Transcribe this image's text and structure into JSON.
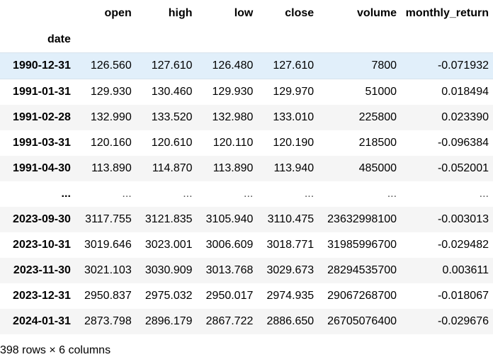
{
  "columns": [
    "open",
    "high",
    "low",
    "close",
    "volume",
    "monthly_return"
  ],
  "index_name": "date",
  "rows": [
    {
      "index": "1990-12-31",
      "open": "126.560",
      "high": "127.610",
      "low": "126.480",
      "close": "127.610",
      "volume": "7800",
      "monthly_return": "-0.071932"
    },
    {
      "index": "1991-01-31",
      "open": "129.930",
      "high": "130.460",
      "low": "129.930",
      "close": "129.970",
      "volume": "51000",
      "monthly_return": "0.018494"
    },
    {
      "index": "1991-02-28",
      "open": "132.990",
      "high": "133.520",
      "low": "132.980",
      "close": "133.010",
      "volume": "225800",
      "monthly_return": "0.023390"
    },
    {
      "index": "1991-03-31",
      "open": "120.160",
      "high": "120.610",
      "low": "120.110",
      "close": "120.190",
      "volume": "218500",
      "monthly_return": "-0.096384"
    },
    {
      "index": "1991-04-30",
      "open": "113.890",
      "high": "114.870",
      "low": "113.890",
      "close": "113.940",
      "volume": "485000",
      "monthly_return": "-0.052001"
    },
    {
      "index": "...",
      "open": "...",
      "high": "...",
      "low": "...",
      "close": "...",
      "volume": "...",
      "monthly_return": "..."
    },
    {
      "index": "2023-09-30",
      "open": "3117.755",
      "high": "3121.835",
      "low": "3105.940",
      "close": "3110.475",
      "volume": "23632998100",
      "monthly_return": "-0.003013"
    },
    {
      "index": "2023-10-31",
      "open": "3019.646",
      "high": "3023.001",
      "low": "3006.609",
      "close": "3018.771",
      "volume": "31985996700",
      "monthly_return": "-0.029482"
    },
    {
      "index": "2023-11-30",
      "open": "3021.103",
      "high": "3030.909",
      "low": "3013.768",
      "close": "3029.673",
      "volume": "28294535700",
      "monthly_return": "0.003611"
    },
    {
      "index": "2023-12-31",
      "open": "2950.837",
      "high": "2975.032",
      "low": "2950.017",
      "close": "2974.935",
      "volume": "29067268700",
      "monthly_return": "-0.018067"
    },
    {
      "index": "2024-01-31",
      "open": "2873.798",
      "high": "2896.179",
      "low": "2867.722",
      "close": "2886.650",
      "volume": "26705076400",
      "monthly_return": "-0.029676"
    }
  ],
  "highlighted_row": 0,
  "footer": "398 rows × 6 columns",
  "colors": {
    "row_stripe": "#f5f5f5",
    "row_highlight": "#e1effa"
  }
}
